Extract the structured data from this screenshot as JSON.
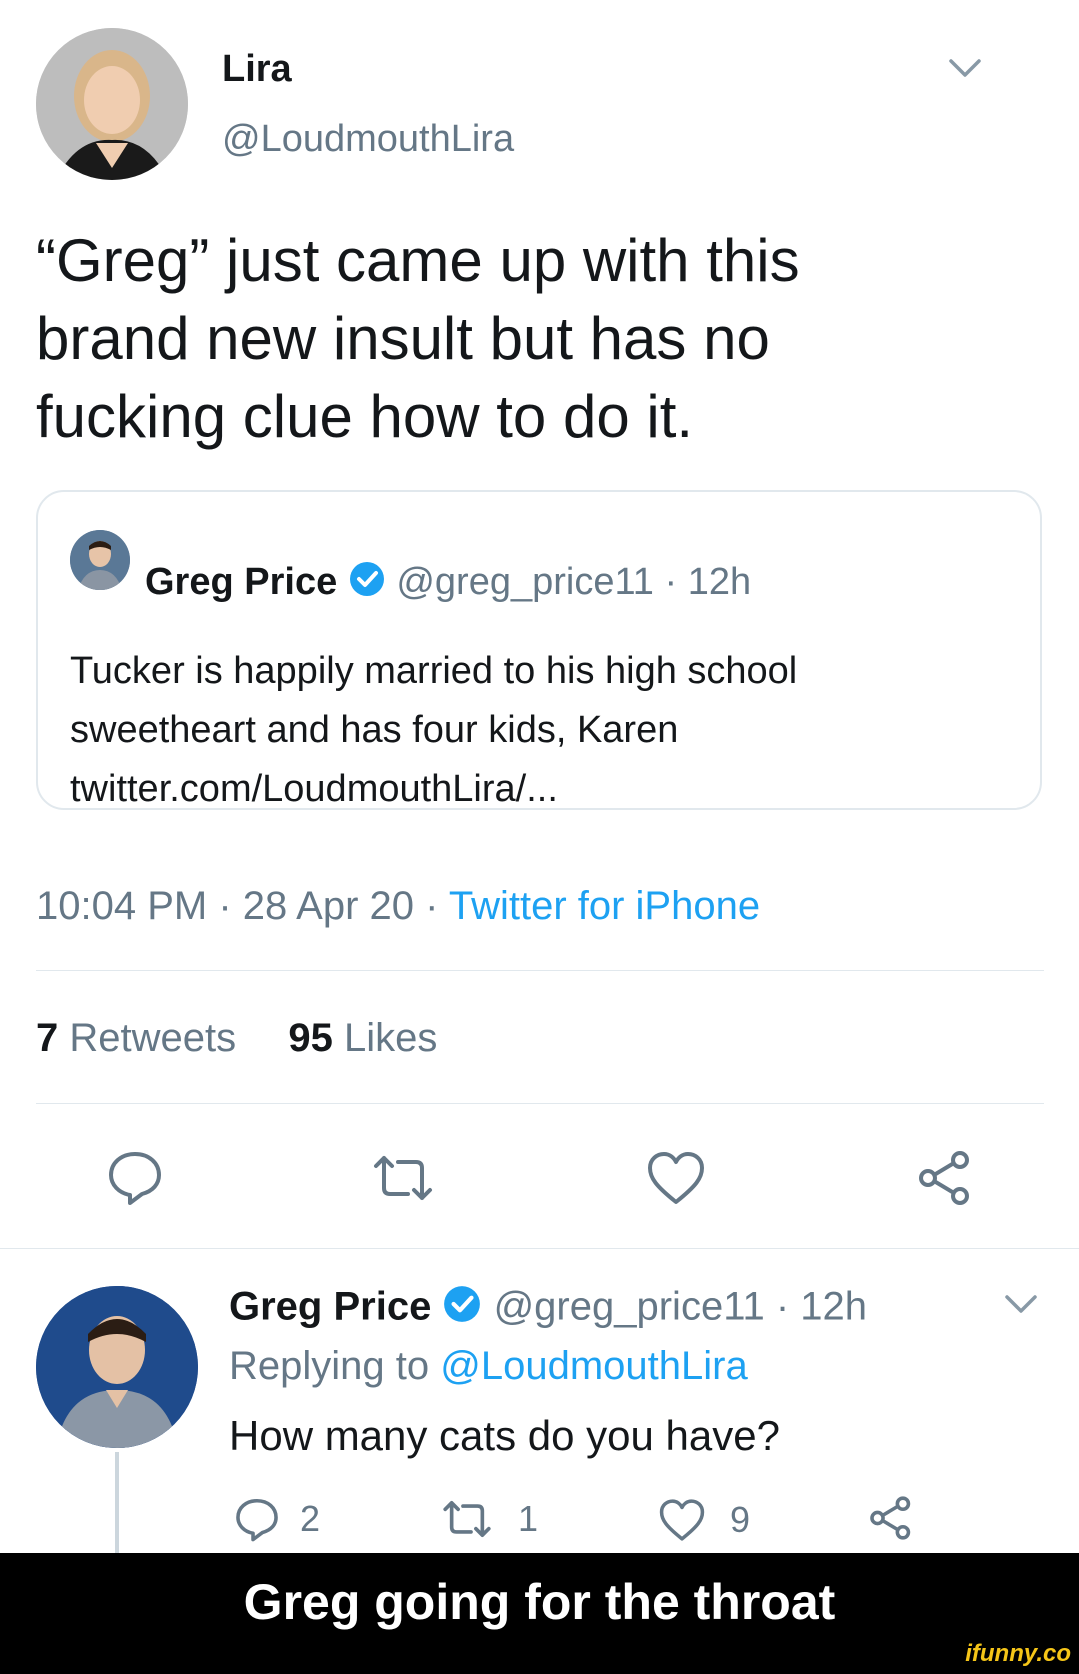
{
  "main_tweet": {
    "display_name": "Lira",
    "handle": "@LoudmouthLira",
    "text_lines": [
      "“Greg” just came up with this",
      "brand new insult but has no",
      "fucking clue how to do it."
    ],
    "timestamp": "10:04 PM · 28 Apr 20 · ",
    "source": "Twitter for iPhone",
    "retweets_count": "7",
    "retweets_label": "Retweets",
    "likes_count": "95",
    "likes_label": "Likes"
  },
  "quoted_tweet": {
    "display_name": "Greg Price",
    "handle": "@greg_price11 · 12h",
    "text_lines": [
      "Tucker is happily married to his high school",
      "sweetheart and has four kids, Karen",
      "twitter.com/LoudmouthLira/..."
    ]
  },
  "reply": {
    "display_name": "Greg Price",
    "handle": "@greg_price11 · 12h",
    "replying_prefix": "Replying to ",
    "replying_handle": "@LoudmouthLira",
    "text": "How many cats do you have?",
    "reply_count": "2",
    "retweet_count": "1",
    "like_count": "9"
  },
  "caption": "Greg going for the throat",
  "watermark": "ifunny.co",
  "colors": {
    "accent": "#1da1f2",
    "muted": "#657786",
    "divider": "#e1e8ed"
  }
}
